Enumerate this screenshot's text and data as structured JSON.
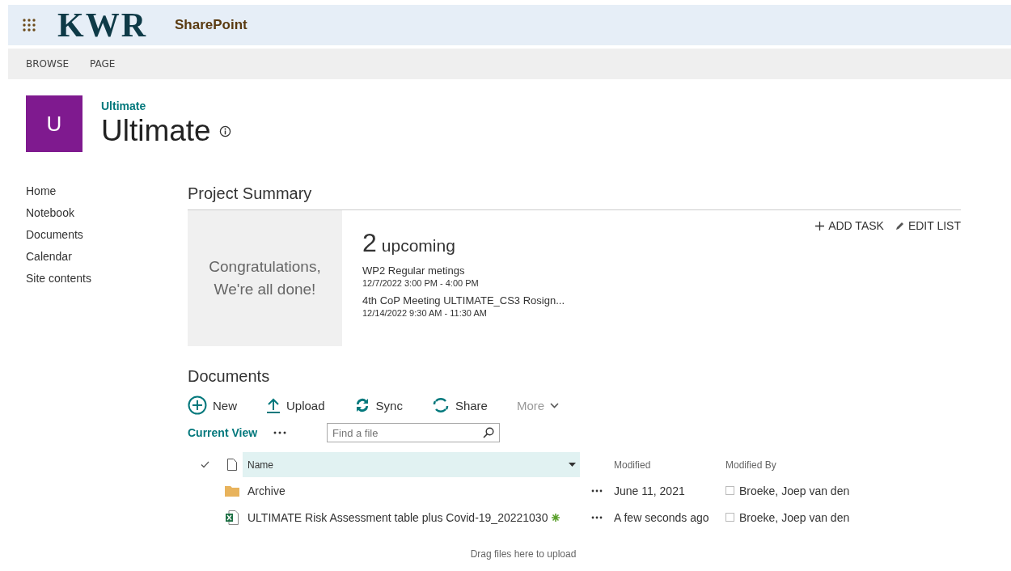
{
  "suite_bar": {
    "logo": "KWR",
    "app_name": "SharePoint"
  },
  "ribbon_tabs": [
    {
      "label": "BROWSE",
      "selected": false
    },
    {
      "label": "PAGE",
      "selected": false
    }
  ],
  "site": {
    "tile_letter": "U",
    "breadcrumb": "Ultimate",
    "title": "Ultimate"
  },
  "nav": [
    {
      "label": "Home"
    },
    {
      "label": "Notebook"
    },
    {
      "label": "Documents"
    },
    {
      "label": "Calendar"
    },
    {
      "label": "Site contents"
    }
  ],
  "project_summary": {
    "heading": "Project Summary",
    "done_message": "Congratulations, We're all done!",
    "count": "2",
    "count_label": "upcoming",
    "events": [
      {
        "title": "WP2 Regular metings",
        "time": "12/7/2022 3:00 PM - 4:00 PM"
      },
      {
        "title": "4th CoP Meeting ULTIMATE_CS3 Rosign...",
        "time": "12/14/2022 9:30 AM - 11:30 AM"
      }
    ],
    "actions": [
      {
        "kind": "add",
        "label": "ADD TASK"
      },
      {
        "kind": "edit",
        "label": "EDIT LIST"
      }
    ]
  },
  "documents": {
    "heading": "Documents",
    "commands": [
      {
        "kind": "new",
        "label": "New",
        "disabled": false
      },
      {
        "kind": "upload",
        "label": "Upload",
        "disabled": false
      },
      {
        "kind": "sync",
        "label": "Sync",
        "disabled": false
      },
      {
        "kind": "share",
        "label": "Share",
        "disabled": false
      },
      {
        "kind": "more",
        "label": "More",
        "disabled": true
      }
    ],
    "current_view": "Current View",
    "search": {
      "placeholder": "Find a file"
    },
    "columns": [
      "Name",
      "Modified",
      "Modified By"
    ],
    "rows": [
      {
        "kind": "folder",
        "name": "Archive",
        "is_new": false,
        "modified": "June 11, 2021",
        "modified_by": "Broeke, Joep van den"
      },
      {
        "kind": "excel",
        "name": "ULTIMATE Risk Assessment table plus Covid-19_20221030",
        "is_new": true,
        "modified": "A few seconds ago",
        "modified_by": "Broeke, Joep van den"
      }
    ],
    "drop_hint": "Drag files here to upload"
  }
}
